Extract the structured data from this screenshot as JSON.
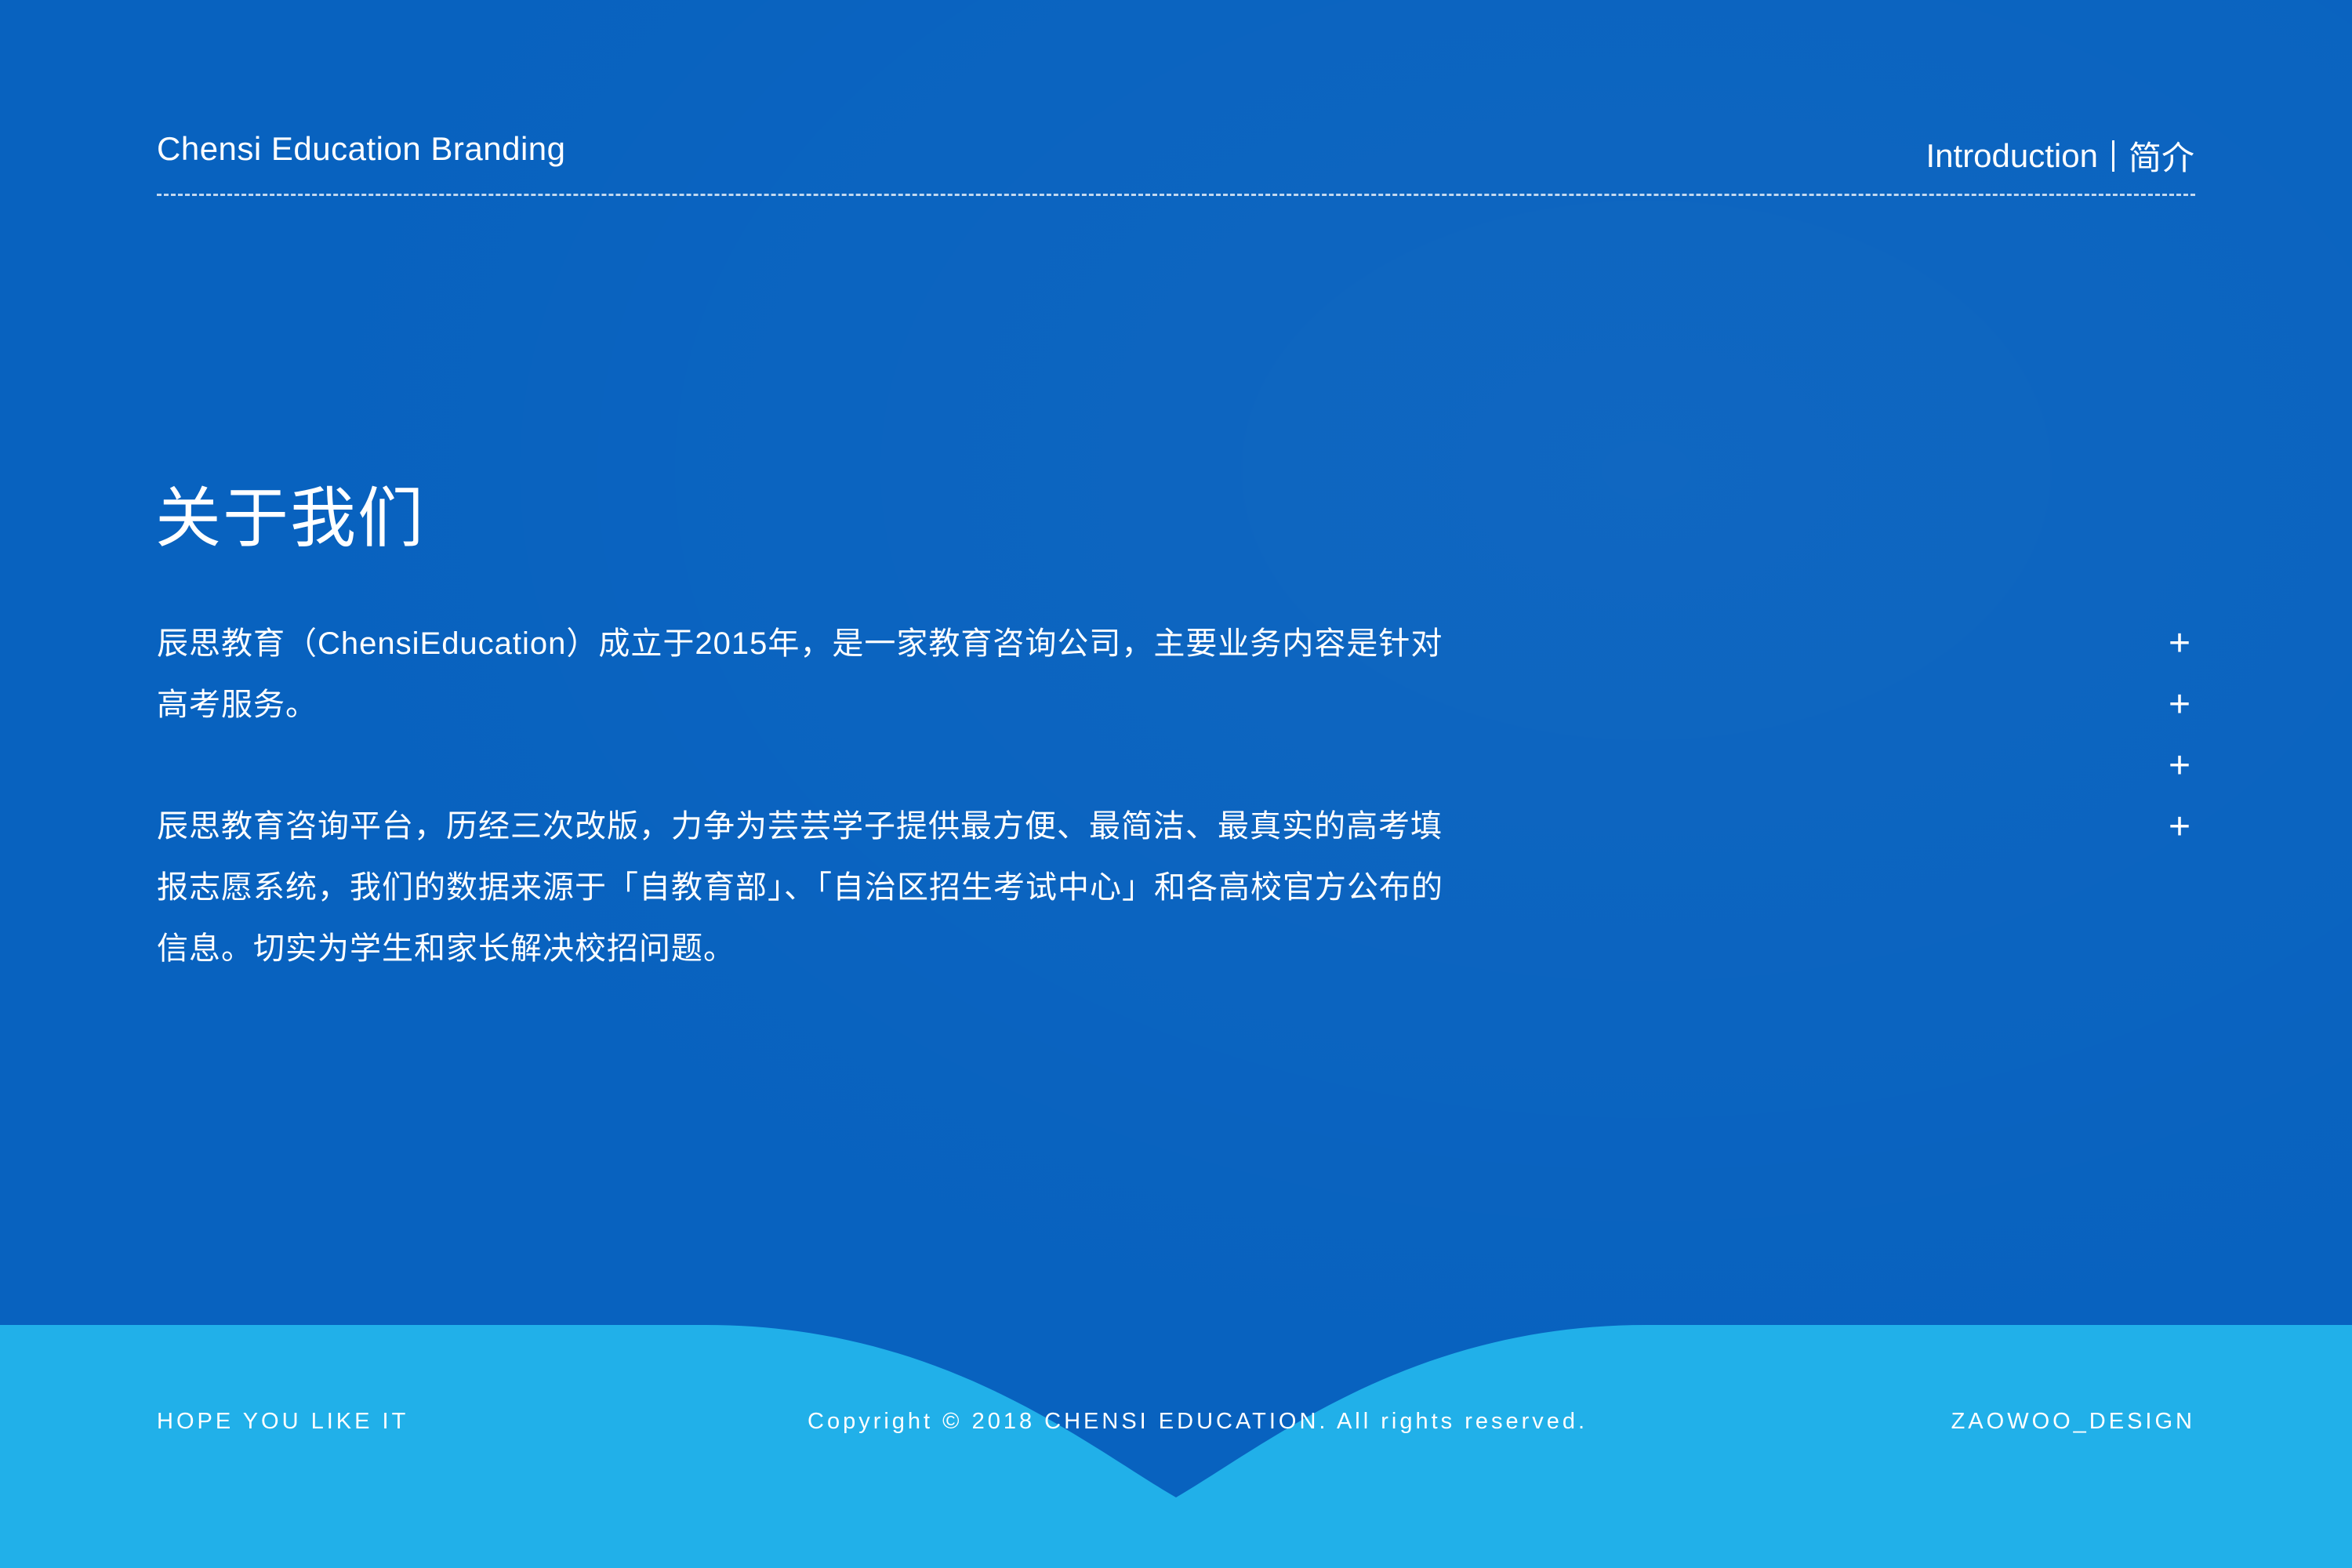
{
  "header": {
    "brand": "Chensi Education Branding",
    "section_en": "Introduction",
    "section_cn": "简介"
  },
  "main": {
    "title": "关于我们",
    "paragraphs": [
      "辰思教育（ChensiEducation）成立于2015年，是一家教育咨询公司，主要业务内容是针对高考服务。",
      "辰思教育咨询平台，历经三次改版，力争为芸芸学子提供最方便、最简洁、最真实的高考填报志愿系统，我们的数据来源于「自教育部」、「自治区招生考试中心」和各高校官方公布的信息。切实为学生和家长解决校招问题。"
    ],
    "plus_marks": [
      "+",
      "+",
      "+",
      "+"
    ]
  },
  "footer": {
    "left": "HOPE YOU LIKE IT",
    "center": "Copyright © 2018 CHENSI EDUCATION. All rights reserved.",
    "right": "ZAOWOO_DESIGN"
  },
  "colors": {
    "background": "#0862bf",
    "footer_wave": "#21b0e9",
    "text": "#ffffff"
  }
}
